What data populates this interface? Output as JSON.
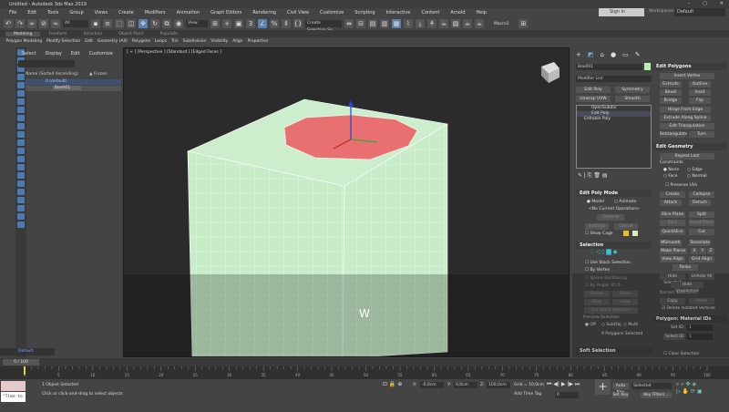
{
  "window": {
    "title": "Untitled - Autodesk 3ds Max 2019",
    "controls": [
      "–",
      "▢",
      "✕"
    ]
  },
  "menu": [
    "File",
    "Edit",
    "Tools",
    "Group",
    "Views",
    "Create",
    "Modifiers",
    "Animation",
    "Graph Editors",
    "Rendering",
    "Civil View",
    "Customize",
    "Scripting",
    "Interactive",
    "Content",
    "Arnold",
    "Help"
  ],
  "account": {
    "sign_in": "Sign In",
    "workspaces_label": "Workspaces:",
    "workspace": "Default"
  },
  "toolbar": {
    "filter": "All",
    "view": "View",
    "selection_set": "Create Selection Se",
    "macro": "Macro1"
  },
  "ribbon": {
    "tabs": [
      "Modeling",
      "Freeform",
      "Selection",
      "Object Paint",
      "Populate"
    ],
    "active": "Modeling",
    "panels": [
      "Polygon Modeling",
      "Modify Selection",
      "Edit",
      "Geometry (All)",
      "Polygons",
      "Loops",
      "Tris",
      "Subdivision",
      "Visibility",
      "Align",
      "Properties"
    ]
  },
  "explorer": {
    "menu": [
      "Select",
      "Display",
      "Edit",
      "Customize"
    ],
    "col_name": "Name (Sorted Ascending)",
    "col_frozen": "▲ Frozen",
    "rows": [
      "0 (default)",
      "Box001"
    ],
    "layer": "Default"
  },
  "viewport": {
    "label": "[ + ] [Perspective ] [Standard ] [Edged Faces ]",
    "overlay_text": "W",
    "colors": {
      "mesh": "#c8ecc8",
      "selected": "#e87070"
    }
  },
  "command_panel": {
    "object_name": "Box001",
    "object_color": "#b8f0b0",
    "modifier_list": "Modifier List",
    "quick_buttons": [
      "Edit Poly",
      "Symmetry",
      "Unwrap UVW",
      "Smooth"
    ],
    "stack": [
      "OpenSubdiv",
      "Edit Poly",
      "Editable Poly"
    ],
    "edit_poly_mode": {
      "title": "Edit Poly Mode",
      "model": "Model",
      "animate": "Animate",
      "operation": "<No Current Operation>",
      "commit": "Commit",
      "settings": "Settings",
      "cancel": "Cancel",
      "show_cage": "Show Cage"
    },
    "selection": {
      "title": "Selection",
      "use_stack": "Use Stack Selection",
      "by_vertex": "By Vertex",
      "ignore_backfacing": "Ignore Backfacing",
      "by_angle": "By Angle:",
      "angle": "45.0",
      "shrink": "Shrink",
      "grow": "Grow",
      "ring": "Ring",
      "loop": "Loop",
      "get_stack": "Get Stack Selection",
      "preview": "Preview Selection",
      "off": "Off",
      "subobj": "SubObj",
      "multi": "Multi",
      "status": "9 Polygons Selected"
    },
    "soft_selection": "Soft Selection",
    "edit_polygons": {
      "title": "Edit Polygons",
      "buttons": [
        "Insert Vertex",
        "Extrude",
        "Outline",
        "Bevel",
        "Inset",
        "Bridge",
        "Flip",
        "Hinge From Edge",
        "Extrude Along Spline",
        "Edit Triangulation",
        "Retriangulate",
        "Turn"
      ]
    },
    "edit_geometry": {
      "title": "Edit Geometry",
      "repeat_last": "Repeat Last",
      "constraints": "Constraints",
      "none": "None",
      "edge": "Edge",
      "face": "Face",
      "normal": "Normal",
      "preserve_uvs": "Preserve UVs",
      "buttons": [
        "Create",
        "Collapse",
        "Attach",
        "Detach",
        "Slice Plane",
        "Split",
        "Slice",
        "Reset Plane",
        "QuickSlice",
        "Cut",
        "MSmooth",
        "Tessellate",
        "Make Planar",
        "X",
        "Y",
        "Z",
        "View Align",
        "Grid Align",
        "Relax",
        "Hide Selected",
        "Unhide All",
        "Hide Unselected"
      ],
      "named_selections": "Named Selections:",
      "copy": "Copy",
      "paste": "Paste",
      "delete_isolated": "Delete Isolated Vertices"
    },
    "material_ids": {
      "title": "Polygon: Material IDs",
      "set_id": "Set ID:",
      "select_id": "Select ID",
      "set_val": "1",
      "select_val": "1",
      "clear_selection": "Clear Selection"
    }
  },
  "timeline": {
    "frame": "0 / 100",
    "ticks": [
      "0",
      "5",
      "10",
      "15",
      "20",
      "25",
      "30",
      "35",
      "40",
      "45",
      "50",
      "55",
      "60",
      "65",
      "70",
      "75",
      "80",
      "85",
      "90",
      "95",
      "100"
    ]
  },
  "status": {
    "maxscript": "\"Time to sol\"",
    "selected": "1 Object Selected",
    "prompt": "Click or click-and-drag to select objects",
    "x": "-0,0cm",
    "y": "0,0cm",
    "z": "100,0cm",
    "grid": "Grid = 10,0cm",
    "add_time_tag": "Add Time Tag",
    "auto_key": "Auto Key",
    "set_key": "Set Key",
    "key_mode": "Selected",
    "key_filters": "Key Filters...",
    "current_frame": "0"
  }
}
